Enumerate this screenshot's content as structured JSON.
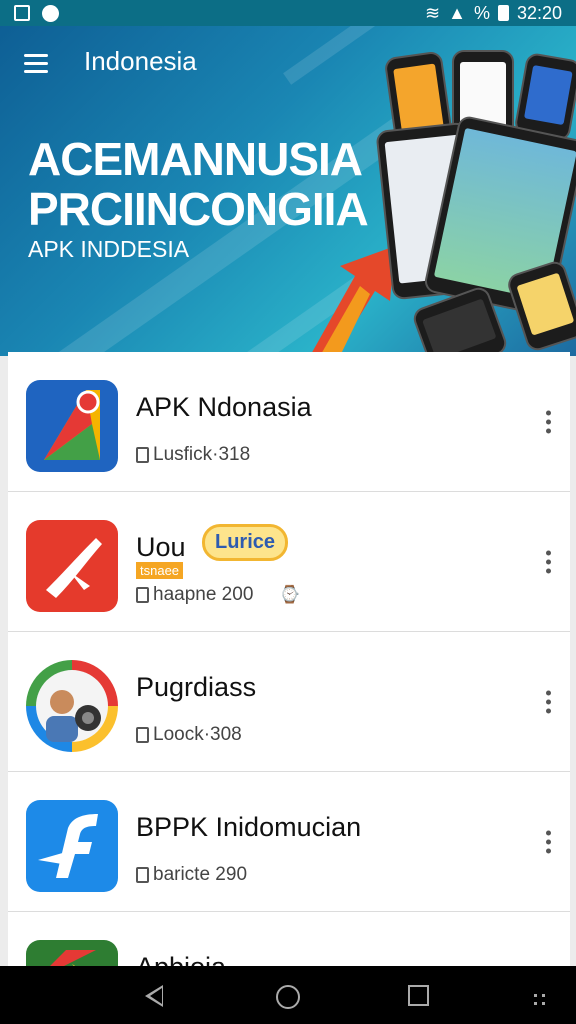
{
  "status_bar": {
    "time": "32:20",
    "signal_text": "%"
  },
  "banner": {
    "title": "Indonesia",
    "headline_line1": "ACEMANNUSIA",
    "headline_line2": "PRCIINCONGIIA",
    "subheadline": "APK INDDESIA"
  },
  "apps": [
    {
      "name": "APK Ndonasia",
      "meta": "Lusfick·318",
      "icon": "maps-pin-icon"
    },
    {
      "name": "Uou",
      "badge": "Lurice",
      "sub_badge": "tsnaee",
      "meta": "haapne 200",
      "trailing": "⌚",
      "icon": "runner-icon"
    },
    {
      "name": "Pugrdiass",
      "meta": "Loock·308",
      "icon": "avatar-speaker-icon"
    },
    {
      "name": "BPPK Inidomucian",
      "meta": "baricte 290",
      "icon": "f-logo-icon"
    },
    {
      "name": "Apbioia",
      "meta": "",
      "icon": "arrow-logo-icon"
    }
  ],
  "colors": {
    "status_bar": "#0c6e86",
    "banner_gradient_start": "#0e5f95",
    "banner_gradient_end": "#2ab2c9",
    "badge_border": "#f2b631",
    "badge_text": "#2e5bb0",
    "nav_bar": "#000000"
  },
  "nav": {
    "back_icon": "back-triangle-icon",
    "home_icon": "home-circle-icon",
    "recent_icon": "recent-square-icon"
  }
}
